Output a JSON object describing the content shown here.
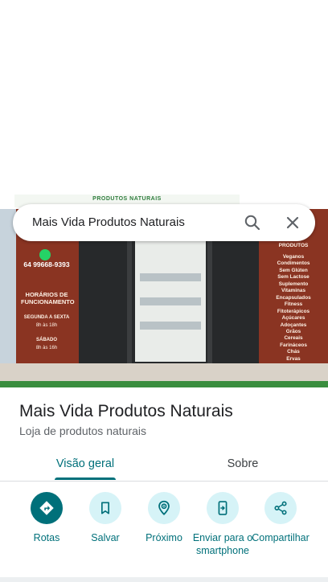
{
  "search": {
    "query": "Mais Vida Produtos Naturais"
  },
  "photo": {
    "top_sign": "PRODUTOS NATURAIS",
    "phone": "64 99668-9393",
    "hours_title": "HORÁRIOS DE FUNCIONAMENTO",
    "weekday_label": "SEGUNDA A SEXTA",
    "weekday_time": "8h às 18h",
    "saturday_label": "SÁBADO",
    "saturday_time": "8h às 16h",
    "products_title": "PRODUTOS",
    "products": "Veganos\nCondimentos\nSem Glúten\nSem Lactose\nSuplemento\nVitaminas\nEncapsulados\nFitness\nFitoterápicos\nAçúcares\nAdoçantes\nGrãos\nCereais\nFarináceos\nChás\nErvas"
  },
  "place": {
    "title": "Mais Vida Produtos Naturais",
    "category": "Loja de produtos naturais"
  },
  "tabs": [
    {
      "label": "Visão geral",
      "active": true
    },
    {
      "label": "Sobre",
      "active": false
    }
  ],
  "actions": [
    {
      "label": "Rotas",
      "icon": "directions-icon"
    },
    {
      "label": "Salvar",
      "icon": "bookmark-icon"
    },
    {
      "label": "Próximo",
      "icon": "nearby-icon"
    },
    {
      "label": "Enviar para o smartphone",
      "icon": "send-to-phone-icon"
    },
    {
      "label": "Compartilhar",
      "icon": "share-icon"
    }
  ],
  "colors": {
    "accent": "#00707a",
    "accent_light": "#d6f3f7",
    "title_text": "#202124",
    "secondary_text": "#5f6368"
  }
}
